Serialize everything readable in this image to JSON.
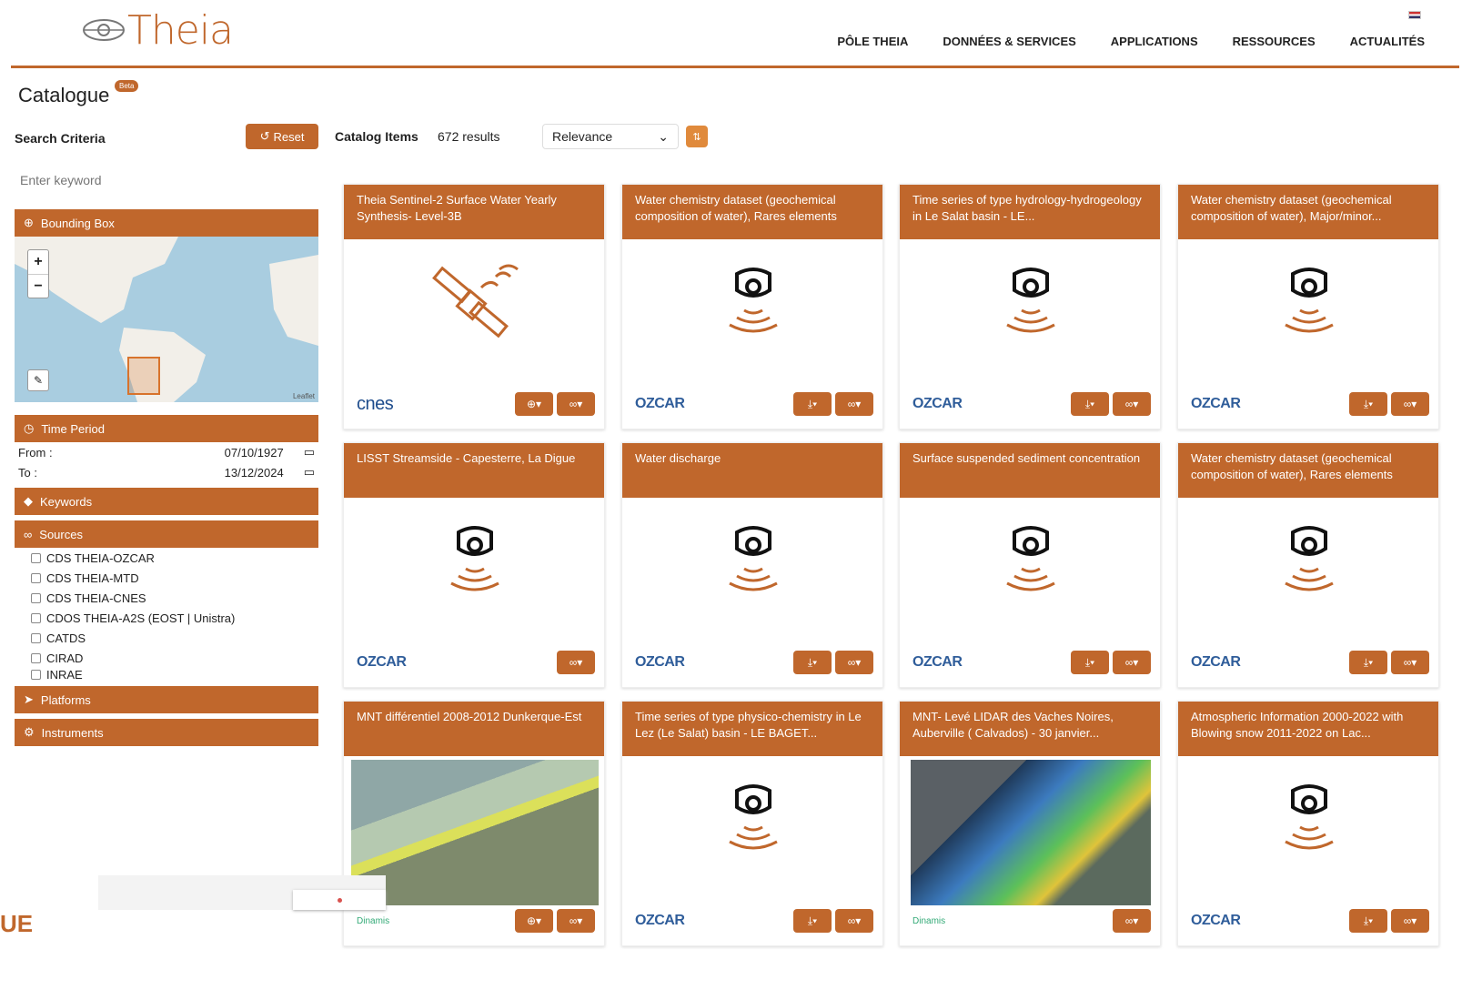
{
  "brand": {
    "name": "Theia",
    "accent": "#c0672c"
  },
  "nav": [
    "PÔLE THEIA",
    "DONNÉES & SERVICES",
    "APPLICATIONS",
    "RESSOURCES",
    "ACTUALITÉS"
  ],
  "page": {
    "title": "Catalogue",
    "badge": "Beta"
  },
  "sidebar": {
    "title": "Search Criteria",
    "reset": "Reset",
    "keyword_placeholder": "Enter keyword",
    "bbox": "Bounding Box",
    "map_attr": "Leaflet",
    "time": "Time Period",
    "from_label": "From :",
    "from": "07/10/1927",
    "to_label": "To :",
    "to": "13/12/2024",
    "keywords": "Keywords",
    "sources": "Sources",
    "source_items": [
      "CDS THEIA-OZCAR",
      "CDS THEIA-MTD",
      "CDS THEIA-CNES",
      "CDOS THEIA-A2S (EOST | Unistra)",
      "CATDS",
      "CIRAD",
      "INRAE"
    ],
    "platforms": "Platforms",
    "instruments": "Instruments"
  },
  "catalog": {
    "title": "Catalog Items",
    "count": "672 results",
    "sort": "Relevance"
  },
  "cards": [
    {
      "title": "Theia Sentinel-2 Surface Water Yearly Synthesis- Level-3B",
      "logo": "cnes",
      "icon": "satellite-icon"
    },
    {
      "title": "Water chemistry dataset (geochemical composition of water), Rares elements",
      "logo": "OZCAR",
      "icon": "sensor-icon"
    },
    {
      "title": "Time series of type hydrology-hydrogeology in Le Salat basin - LE...",
      "logo": "OZCAR",
      "icon": "sensor-icon"
    },
    {
      "title": "Water chemistry dataset (geochemical composition of water), Major/minor...",
      "logo": "OZCAR",
      "icon": "sensor-icon"
    },
    {
      "title": "LISST Streamside - Capesterre, La Digue",
      "logo": "OZCAR",
      "icon": "sensor-icon"
    },
    {
      "title": "Water discharge",
      "logo": "OZCAR",
      "icon": "sensor-icon"
    },
    {
      "title": "Surface suspended sediment concentration",
      "logo": "OZCAR",
      "icon": "sensor-icon"
    },
    {
      "title": "Water chemistry dataset (geochemical composition of water), Rares elements",
      "logo": "OZCAR",
      "icon": "sensor-icon"
    },
    {
      "title": "MNT différentiel 2008-2012 Dunkerque-Est",
      "logo": "Dinamis",
      "icon": "map-image"
    },
    {
      "title": "Time series of type physico-chemistry in Le Lez (Le Salat) basin - LE BAGET...",
      "logo": "OZCAR",
      "icon": "sensor-icon"
    },
    {
      "title": "MNT- Levé LIDAR des Vaches Noires, Auberville ( Calvados) - 30 janvier...",
      "logo": "Dinamis",
      "icon": "lidar-image"
    },
    {
      "title": "Atmospheric Information 2000-2022 with Blowing snow 2011-2022 on Lac...",
      "logo": "OZCAR",
      "icon": "sensor-icon"
    }
  ],
  "footer_text": "UE"
}
